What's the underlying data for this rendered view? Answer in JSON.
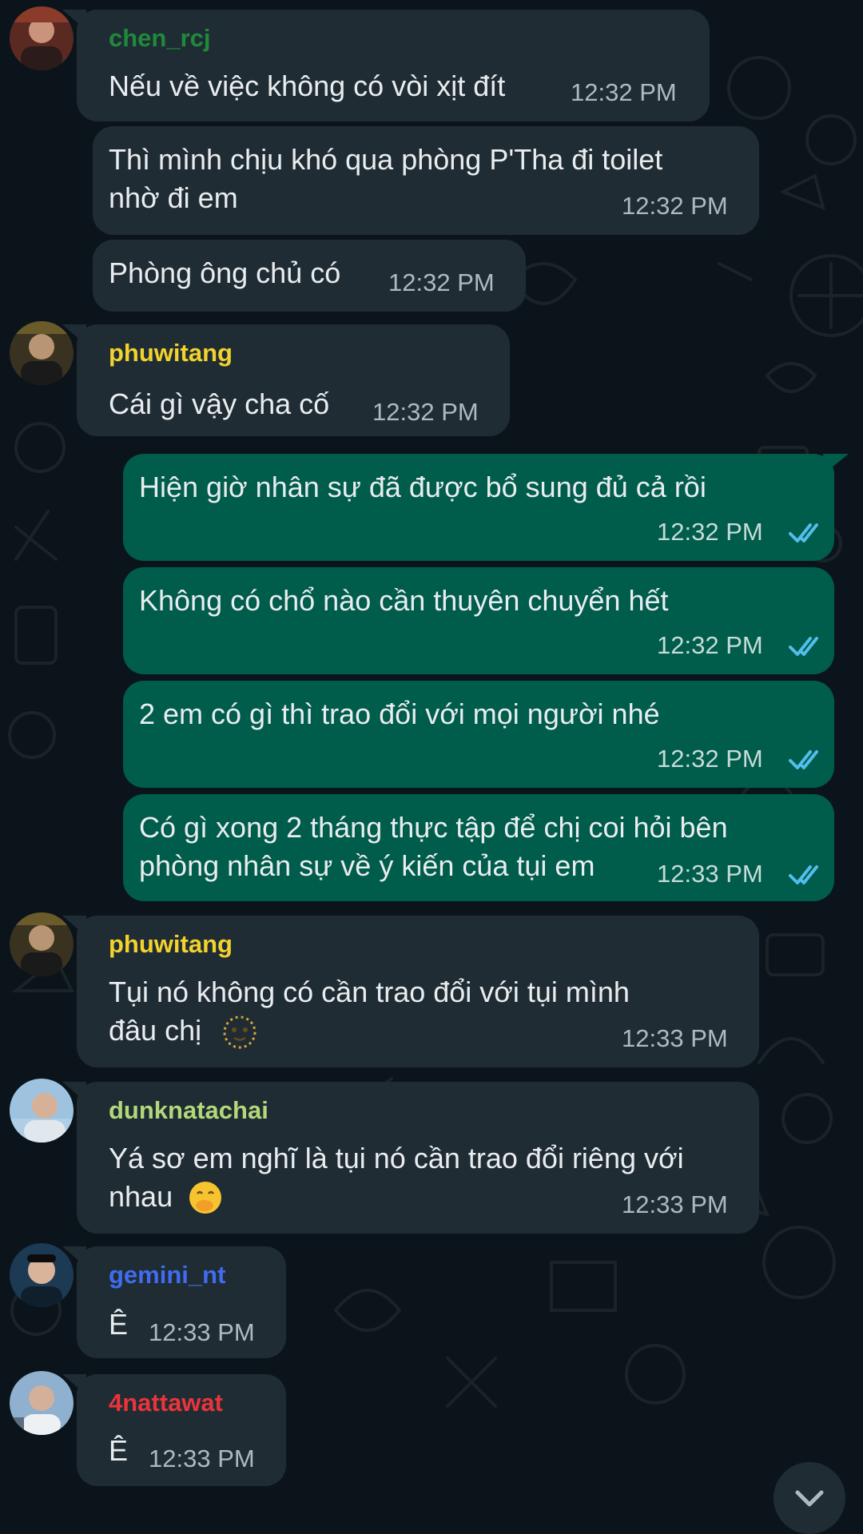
{
  "colors": {
    "background": "#0b141a",
    "incoming_bubble": "#202c33",
    "outgoing_bubble": "#005c4b",
    "read_ticks": "#53bdeb"
  },
  "messages": [
    {
      "sender": "chen_rcj",
      "sender_color": "#1f8a3b",
      "lines": [
        "Nếu về việc không có vòi xịt đít"
      ],
      "time": "12:32 PM"
    },
    {
      "lines": [
        "Thì mình chịu khó qua phòng P'Tha đi toilet",
        "nhờ đi em"
      ],
      "time": "12:32 PM"
    },
    {
      "lines": [
        "Phòng ông chủ có"
      ],
      "time": "12:32 PM"
    },
    {
      "sender": "phuwitang",
      "sender_color": "#f2d22e",
      "lines": [
        "Cái gì vậy cha cố"
      ],
      "time": "12:32 PM"
    },
    {
      "lines": [
        "Hiện giờ nhân sự đã được bổ sung đủ cả rồi"
      ],
      "time": "12:32 PM",
      "status": "read-ticks-icon"
    },
    {
      "lines": [
        "Không có chổ nào cần thuyên chuyển hết"
      ],
      "time": "12:32 PM",
      "status": "read-ticks-icon"
    },
    {
      "lines": [
        "2 em có gì thì trao đổi với mọi người nhé"
      ],
      "time": "12:32 PM",
      "status": "read-ticks-icon"
    },
    {
      "lines": [
        "Có gì xong 2 tháng thực tập để chị coi hỏi bên",
        "phòng nhân sự về ý kiến của tụi em"
      ],
      "time": "12:33 PM",
      "status": "read-ticks-icon"
    },
    {
      "sender": "phuwitang",
      "sender_color": "#f2d22e",
      "lines": [
        "Tụi nó không có cần trao đổi với tụi mình",
        "đâu chị"
      ],
      "time": "12:33 PM",
      "emoji": "dotted-face-emoji"
    },
    {
      "sender": "dunknatachai",
      "sender_color": "#b3d87a",
      "lines": [
        "Yá sơ em nghĩ là tụi nó cần trao đổi riêng với",
        "nhau"
      ],
      "time": "12:33 PM",
      "emoji": "hand-over-mouth-emoji"
    },
    {
      "sender": "gemini_nt",
      "sender_color": "#3f6cf0",
      "lines": [
        "Ê"
      ],
      "time": "12:33 PM"
    },
    {
      "sender": "4nattawat",
      "sender_color": "#e8343c",
      "lines": [
        "Ê"
      ],
      "time": "12:33 PM"
    }
  ],
  "scroll_button": {
    "icon": "chevron-down-icon"
  }
}
